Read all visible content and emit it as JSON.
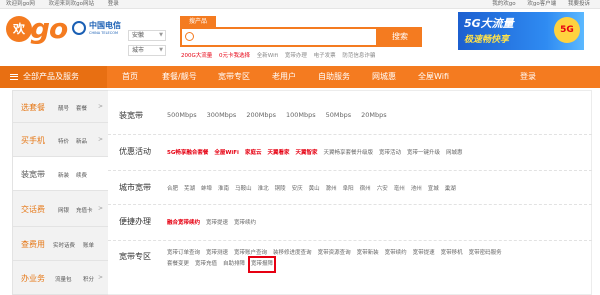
{
  "topbar": {
    "left": [
      "欢迎到go网",
      "欢迎来到欢go网站",
      "登录"
    ],
    "right": [
      "我的欢go",
      "欢go客户端",
      "我要投诉"
    ]
  },
  "logo": {
    "wan": "欢",
    "go": "go"
  },
  "telecom": {
    "name": "中国电信",
    "en": "CHINA TELECOM"
  },
  "location": {
    "province": "安徽",
    "city": "城市"
  },
  "search": {
    "tab": "搜产品",
    "placeholder": "",
    "button": "搜索",
    "hot": [
      "200G大流量",
      "0元卡我选择",
      "全新Wifi",
      "宽带办理",
      "电子发票",
      "防范信息诈骗"
    ]
  },
  "banner": {
    "line1": "5G大流量",
    "line2": "极速畅快享",
    "badge": "5G"
  },
  "nav": {
    "all": "全部产品及服务",
    "items": [
      "首页",
      "套餐/靓号",
      "宽带专区",
      "老用户",
      "自助服务",
      "网城惠",
      "全屋Wifi",
      "登录"
    ]
  },
  "sidebar": [
    {
      "title": "选套餐",
      "subs": [
        "靓号",
        "套餐"
      ]
    },
    {
      "title": "买手机",
      "subs": [
        "特价",
        "新品"
      ]
    },
    {
      "title": "装宽带",
      "subs": [
        "新装",
        "续费"
      ]
    },
    {
      "title": "交话费",
      "subs": [
        "网银",
        "充值卡"
      ]
    },
    {
      "title": "查费用",
      "subs": [
        "实时话费",
        "账单"
      ]
    },
    {
      "title": "办业务",
      "subs": [
        "流量包",
        "积分"
      ]
    }
  ],
  "panel": {
    "sections": [
      {
        "title": "装宽带",
        "links": [
          "500Mbps",
          "300Mbps",
          "200Mbps",
          "100Mbps",
          "50Mbps",
          "20Mbps"
        ]
      },
      {
        "title": "优惠活动",
        "links": [
          "5G畅享融合套餐",
          "全屋WiFi",
          "家庭云",
          "天翼看家",
          "天翼智家",
          "天翼畅享套餐升级版",
          "宽带活动",
          "宽带一键升级",
          "网城惠"
        ]
      },
      {
        "title": "城市宽带",
        "links": [
          "合肥",
          "芜湖",
          "蚌埠",
          "淮南",
          "马鞍山",
          "淮北",
          "铜陵",
          "安庆",
          "黄山",
          "滁州",
          "阜阳",
          "宿州",
          "六安",
          "亳州",
          "池州",
          "宣城",
          "巢湖"
        ]
      },
      {
        "title": "便捷办理",
        "links": [
          "融合宽带续约",
          "宽带提速",
          "宽带续约"
        ]
      },
      {
        "title": "宽带专区",
        "links": [
          "宽带订单查询",
          "宽带测速",
          "宽带账户查询",
          "装移修进度查询",
          "宽带资源查询",
          "宽带新装",
          "宽带续约",
          "宽带提速",
          "宽带移机",
          "宽带密码服务",
          "套餐变更",
          "宽带充值",
          "自助排障",
          "宽带报障"
        ]
      }
    ]
  }
}
